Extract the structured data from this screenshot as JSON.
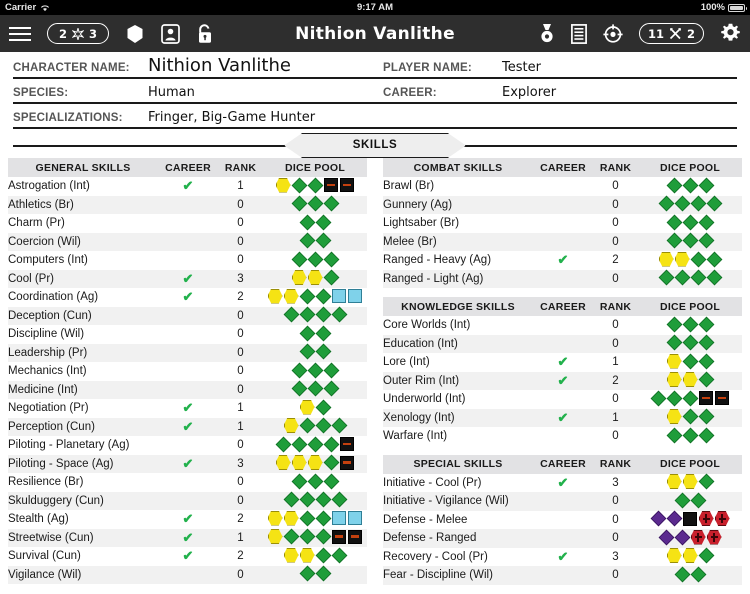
{
  "status_bar": {
    "carrier": "Carrier",
    "time": "9:17 AM",
    "battery": "100%"
  },
  "toolbar": {
    "title": "Nithion Vanlithe",
    "left_pill": {
      "left_value": "2",
      "icon": "star-burst-icon",
      "right_value": "3"
    },
    "right_pill": {
      "left_value": "11",
      "icon": "hammer-wrench-icon",
      "right_value": "2"
    },
    "icons": {
      "menu": "hamburger-menu-icon",
      "shield": "hexagon-shield-icon",
      "portrait": "character-portrait-icon",
      "lock": "unlock-icon",
      "medal": "medal-icon",
      "sheet": "document-list-icon",
      "target": "crosshair-target-icon",
      "settings": "gear-icon"
    }
  },
  "character": {
    "name_label": "CHARACTER NAME:",
    "name_value": "Nithion Vanlithe",
    "player_label": "PLAYER NAME:",
    "player_value": "Tester",
    "species_label": "SPECIES:",
    "species_value": "Human",
    "career_label": "CAREER:",
    "career_value": "Explorer",
    "spec_label": "SPECIALIZATIONS:",
    "spec_value": "Fringer, Big-Game Hunter"
  },
  "section_banner": "SKILLS",
  "columns": {
    "career_header": "CAREER",
    "rank_header": "RANK",
    "pool_header": "DICE POOL",
    "career_check": "✔"
  },
  "tables": [
    {
      "id": "general-skills",
      "header": "GENERAL SKILLS",
      "rows": [
        {
          "name": "Astrogation (Int)",
          "career": true,
          "rank": "1",
          "pool": [
            "prof",
            "ability",
            "ability",
            "setback",
            "setback"
          ]
        },
        {
          "name": "Athletics (Br)",
          "career": false,
          "rank": "0",
          "pool": [
            "ability",
            "ability",
            "ability"
          ]
        },
        {
          "name": "Charm (Pr)",
          "career": false,
          "rank": "0",
          "pool": [
            "ability",
            "ability"
          ]
        },
        {
          "name": "Coercion (Wil)",
          "career": false,
          "rank": "0",
          "pool": [
            "ability",
            "ability"
          ]
        },
        {
          "name": "Computers (Int)",
          "career": false,
          "rank": "0",
          "pool": [
            "ability",
            "ability",
            "ability"
          ]
        },
        {
          "name": "Cool (Pr)",
          "career": true,
          "rank": "3",
          "pool": [
            "prof",
            "prof",
            "ability"
          ]
        },
        {
          "name": "Coordination (Ag)",
          "career": true,
          "rank": "2",
          "pool": [
            "prof",
            "prof",
            "ability",
            "ability",
            "boost",
            "boost"
          ]
        },
        {
          "name": "Deception (Cun)",
          "career": false,
          "rank": "0",
          "pool": [
            "ability",
            "ability",
            "ability",
            "ability"
          ]
        },
        {
          "name": "Discipline (Wil)",
          "career": false,
          "rank": "0",
          "pool": [
            "ability",
            "ability"
          ]
        },
        {
          "name": "Leadership (Pr)",
          "career": false,
          "rank": "0",
          "pool": [
            "ability",
            "ability"
          ]
        },
        {
          "name": "Mechanics (Int)",
          "career": false,
          "rank": "0",
          "pool": [
            "ability",
            "ability",
            "ability"
          ]
        },
        {
          "name": "Medicine (Int)",
          "career": false,
          "rank": "0",
          "pool": [
            "ability",
            "ability",
            "ability"
          ]
        },
        {
          "name": "Negotiation (Pr)",
          "career": true,
          "rank": "1",
          "pool": [
            "prof",
            "ability"
          ]
        },
        {
          "name": "Perception (Cun)",
          "career": true,
          "rank": "1",
          "pool": [
            "prof",
            "ability",
            "ability",
            "ability"
          ]
        },
        {
          "name": "Piloting - Planetary (Ag)",
          "career": false,
          "rank": "0",
          "pool": [
            "ability",
            "ability",
            "ability",
            "ability",
            "setback"
          ]
        },
        {
          "name": "Piloting - Space (Ag)",
          "career": true,
          "rank": "3",
          "pool": [
            "prof",
            "prof",
            "prof",
            "ability",
            "setback"
          ]
        },
        {
          "name": "Resilience (Br)",
          "career": false,
          "rank": "0",
          "pool": [
            "ability",
            "ability",
            "ability"
          ]
        },
        {
          "name": "Skulduggery (Cun)",
          "career": false,
          "rank": "0",
          "pool": [
            "ability",
            "ability",
            "ability",
            "ability"
          ]
        },
        {
          "name": "Stealth (Ag)",
          "career": true,
          "rank": "2",
          "pool": [
            "prof",
            "prof",
            "ability",
            "ability",
            "boost",
            "boost"
          ]
        },
        {
          "name": "Streetwise (Cun)",
          "career": true,
          "rank": "1",
          "pool": [
            "prof",
            "ability",
            "ability",
            "ability",
            "setback",
            "setback"
          ]
        },
        {
          "name": "Survival (Cun)",
          "career": true,
          "rank": "2",
          "pool": [
            "prof",
            "prof",
            "ability",
            "ability"
          ]
        },
        {
          "name": "Vigilance (Wil)",
          "career": false,
          "rank": "0",
          "pool": [
            "ability",
            "ability"
          ]
        }
      ]
    },
    {
      "id": "combat-skills",
      "header": "COMBAT SKILLS",
      "rows": [
        {
          "name": "Brawl (Br)",
          "career": false,
          "rank": "0",
          "pool": [
            "ability",
            "ability",
            "ability"
          ]
        },
        {
          "name": "Gunnery (Ag)",
          "career": false,
          "rank": "0",
          "pool": [
            "ability",
            "ability",
            "ability",
            "ability"
          ]
        },
        {
          "name": "Lightsaber (Br)",
          "career": false,
          "rank": "0",
          "pool": [
            "ability",
            "ability",
            "ability"
          ]
        },
        {
          "name": "Melee (Br)",
          "career": false,
          "rank": "0",
          "pool": [
            "ability",
            "ability",
            "ability"
          ]
        },
        {
          "name": "Ranged - Heavy (Ag)",
          "career": true,
          "rank": "2",
          "pool": [
            "prof",
            "prof",
            "ability",
            "ability"
          ]
        },
        {
          "name": "Ranged - Light (Ag)",
          "career": false,
          "rank": "0",
          "pool": [
            "ability",
            "ability",
            "ability",
            "ability"
          ]
        }
      ]
    },
    {
      "id": "knowledge-skills",
      "header": "KNOWLEDGE SKILLS",
      "rows": [
        {
          "name": "Core Worlds (Int)",
          "career": false,
          "rank": "0",
          "pool": [
            "ability",
            "ability",
            "ability"
          ]
        },
        {
          "name": "Education (Int)",
          "career": false,
          "rank": "0",
          "pool": [
            "ability",
            "ability",
            "ability"
          ]
        },
        {
          "name": "Lore (Int)",
          "career": true,
          "rank": "1",
          "pool": [
            "prof",
            "ability",
            "ability"
          ]
        },
        {
          "name": "Outer Rim (Int)",
          "career": true,
          "rank": "2",
          "pool": [
            "prof",
            "prof",
            "ability"
          ]
        },
        {
          "name": "Underworld (Int)",
          "career": false,
          "rank": "0",
          "pool": [
            "ability",
            "ability",
            "ability",
            "setback",
            "setback"
          ]
        },
        {
          "name": "Xenology (Int)",
          "career": true,
          "rank": "1",
          "pool": [
            "prof",
            "ability",
            "ability"
          ]
        },
        {
          "name": "Warfare (Int)",
          "career": false,
          "rank": "0",
          "pool": [
            "ability",
            "ability",
            "ability"
          ]
        }
      ]
    },
    {
      "id": "special-skills",
      "header": "SPECIAL SKILLS",
      "rows": [
        {
          "name": "Initiative - Cool (Pr)",
          "career": true,
          "rank": "3",
          "pool": [
            "prof",
            "prof",
            "ability"
          ]
        },
        {
          "name": "Initiative - Vigilance (Wil)",
          "career": false,
          "rank": "0",
          "pool": [
            "ability",
            "ability"
          ]
        },
        {
          "name": "Defense - Melee",
          "career": false,
          "rank": "0",
          "pool": [
            "diff",
            "diff",
            "blk",
            "chal",
            "chal"
          ]
        },
        {
          "name": "Defense - Ranged",
          "career": false,
          "rank": "0",
          "pool": [
            "diff",
            "diff",
            "chal",
            "chal"
          ]
        },
        {
          "name": "Recovery - Cool (Pr)",
          "career": true,
          "rank": "3",
          "pool": [
            "prof",
            "prof",
            "ability"
          ]
        },
        {
          "name": "Fear - Discipline (Wil)",
          "career": false,
          "rank": "0",
          "pool": [
            "ability",
            "ability"
          ]
        }
      ]
    }
  ]
}
